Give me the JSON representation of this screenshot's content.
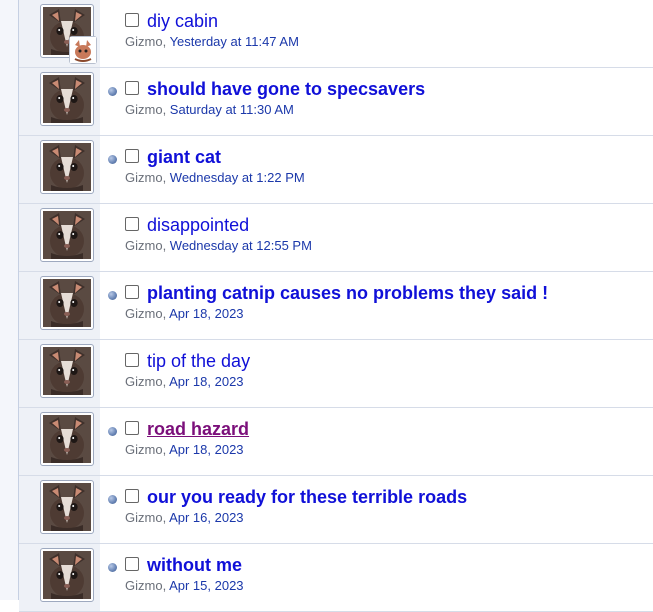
{
  "threads": [
    {
      "title": "diy cabin",
      "author": "Gizmo",
      "sep": ", ",
      "date": "Yesterday at 11:47 AM",
      "unread": false,
      "bold": false,
      "visited": false,
      "has_mini_avatar": true
    },
    {
      "title": "should have gone to specsavers",
      "author": "Gizmo",
      "sep": ", ",
      "date": "Saturday at 11:30 AM",
      "unread": true,
      "bold": true,
      "visited": false,
      "has_mini_avatar": false
    },
    {
      "title": "giant cat",
      "author": "Gizmo",
      "sep": ", ",
      "date": "Wednesday at 1:22 PM",
      "unread": true,
      "bold": true,
      "visited": false,
      "has_mini_avatar": false
    },
    {
      "title": "disappointed",
      "author": "Gizmo",
      "sep": ", ",
      "date": "Wednesday at 12:55 PM",
      "unread": false,
      "bold": false,
      "visited": false,
      "has_mini_avatar": false
    },
    {
      "title": "planting catnip causes no problems they said !",
      "author": "Gizmo",
      "sep": ", ",
      "date": "Apr 18, 2023",
      "unread": true,
      "bold": true,
      "visited": false,
      "has_mini_avatar": false
    },
    {
      "title": "tip of the day",
      "author": "Gizmo",
      "sep": ", ",
      "date": "Apr 18, 2023",
      "unread": false,
      "bold": false,
      "visited": false,
      "has_mini_avatar": false
    },
    {
      "title": "road hazard",
      "author": "Gizmo",
      "sep": ", ",
      "date": "Apr 18, 2023",
      "unread": true,
      "bold": true,
      "visited": true,
      "has_mini_avatar": false
    },
    {
      "title": "our you ready for these terrible roads",
      "author": "Gizmo",
      "sep": ", ",
      "date": "Apr 16, 2023",
      "unread": true,
      "bold": true,
      "visited": false,
      "has_mini_avatar": false
    },
    {
      "title": "without me",
      "author": "Gizmo",
      "sep": ", ",
      "date": "Apr 15, 2023",
      "unread": true,
      "bold": true,
      "visited": false,
      "has_mini_avatar": false
    }
  ],
  "colors": {
    "link": "#1010d8",
    "visited": "#7b0f7a",
    "meta": "#1b38aa",
    "author": "#6a6f79",
    "row_border": "#d6dce8",
    "avatar_bg": "#eef1f7"
  }
}
